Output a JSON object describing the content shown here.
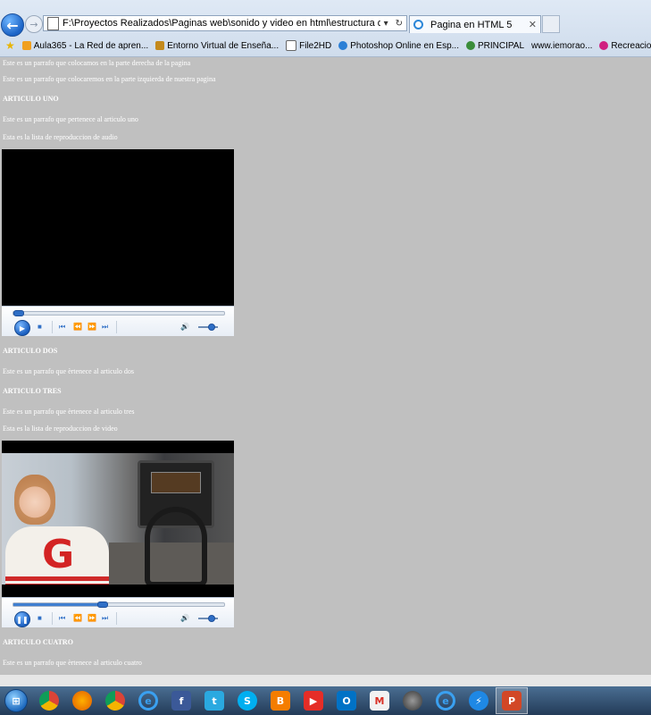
{
  "browser": {
    "address": "F:\\Proyectos Realizados\\Paginas web\\sonido y video en html\\estructura de una pagina web",
    "tab_title": "Pagina en HTML 5",
    "favorites": [
      "Aula365 - La Red de apren...",
      "Entorno Virtual de Enseña...",
      "File2HD",
      "Photoshop Online en Esp...",
      "PRINCIPAL",
      "www.iemorao...",
      "Recreacion de peces en el ..."
    ]
  },
  "content": {
    "p_right": "Este es un parrafo que colocamos en la parte derecha de la pagina",
    "p_left": "Este es un parrafo que colocaremos en la parte izquierda de nuestra pagina",
    "art1_title": "ARTICULO UNO",
    "art1_text": "Este es un parrafo que pertenece al articulo uno",
    "audio_label": "Esta es la lista de reproduccion de audio",
    "art2_title": "ARTICULO DOS",
    "art2_text": "Este es un parrafo que èrtenece al articulo dos",
    "art3_title": "ARTICULO TRES",
    "art3_text": "Este es un parrafo que èrtenece al articulo tres",
    "video_label": "Esta es la lista de reproduccion de video",
    "art4_title": "ARTICULO CUATRO",
    "art4_text": "Este es un parrafo que èrtenece al articulo cuatro"
  },
  "players": {
    "audio": {
      "state": "stopped",
      "progress": 0.02,
      "volume": 0.7
    },
    "video": {
      "state": "playing",
      "progress": 0.42,
      "volume": 0.7
    }
  },
  "colors": {
    "page_bg": "#c0c0c0",
    "text": "#ffffff",
    "player_accent": "#2f6fc6"
  },
  "taskbar": {
    "icons": [
      "start-icon",
      "chrome-icon",
      "firefox-icon",
      "chrome-icon",
      "internet-explorer-icon",
      "facebook-icon",
      "twitter-icon",
      "skype-icon",
      "blogger-icon",
      "youtube-icon",
      "outlook-icon",
      "gmail-icon",
      "media-icon",
      "internet-explorer-icon",
      "thunder-icon",
      "powerpoint-icon"
    ]
  }
}
